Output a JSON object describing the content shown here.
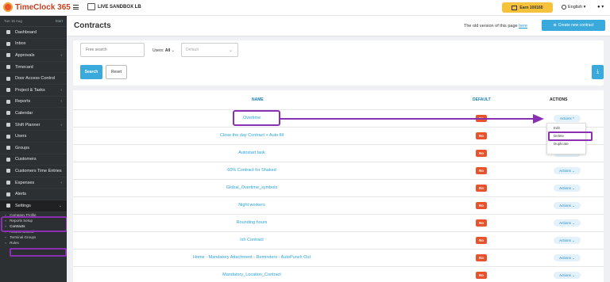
{
  "topbar": {
    "logo_text": "TimeClock 365",
    "sandbox_label": "LIVE SANDBOX LB",
    "earn_label": "Earn 100160",
    "language": "English ▾",
    "user_caret": "▾"
  },
  "sidebar": {
    "date_left": "Tue 16 Aug",
    "date_right": "Start",
    "items": [
      {
        "label": "Dashboard",
        "caret": ""
      },
      {
        "label": "Inbox",
        "caret": ""
      },
      {
        "label": "Approvals",
        "caret": "‹"
      },
      {
        "label": "Timecard",
        "caret": ""
      },
      {
        "label": "Door Access Control",
        "caret": ""
      },
      {
        "label": "Project & Tasks",
        "caret": "‹"
      },
      {
        "label": "Reports",
        "caret": "‹"
      },
      {
        "label": "Calendar",
        "caret": ""
      },
      {
        "label": "Shift Planner",
        "caret": "‹"
      },
      {
        "label": "Users",
        "caret": ""
      },
      {
        "label": "Groups",
        "caret": ""
      },
      {
        "label": "Customers",
        "caret": ""
      },
      {
        "label": "Customers Time Entries",
        "caret": ""
      },
      {
        "label": "Expenses",
        "caret": "‹"
      },
      {
        "label": "Alerts",
        "caret": ""
      },
      {
        "label": "Settings",
        "caret": "⌄"
      }
    ],
    "sub_items": [
      {
        "label": "Company Profile"
      },
      {
        "label": "Reports Setup"
      },
      {
        "label": "Contracts"
      },
      {
        "label": "Access Control"
      },
      {
        "label": "Terminal Groups"
      },
      {
        "label": "Rules"
      }
    ]
  },
  "header": {
    "title": "Contracts",
    "old_version_text": "The old version of this page",
    "old_version_link": "here",
    "create_button": "Create new contract"
  },
  "filters": {
    "search_placeholder": "Free search",
    "users_label": "Users:",
    "users_value": "All",
    "default_placeholder": "Default",
    "search_button": "Search",
    "reset_button": "Reset"
  },
  "table": {
    "columns": {
      "name": "NAME",
      "default": "DEFAULT",
      "actions": "ACTIONS"
    },
    "rows": [
      {
        "name": "Overtime",
        "default": "No",
        "actions": "Actions ^"
      },
      {
        "name": "Close the day Contract + Auto fill",
        "default": "No",
        "actions": "Actions ⌄"
      },
      {
        "name": "Autostart task",
        "default": "No",
        "actions": "Actions ⌄"
      },
      {
        "name": "60% Contract for Shaked",
        "default": "No",
        "actions": "Actions ⌄"
      },
      {
        "name": "Global_Overtime_symbols",
        "default": "No",
        "actions": "Actions ⌄"
      },
      {
        "name": "Night workers",
        "default": "No",
        "actions": "Actions ⌄"
      },
      {
        "name": "Rounding hours",
        "default": "No",
        "actions": "Actions ⌄"
      },
      {
        "name": "Ish Contract",
        "default": "No",
        "actions": "Actions ⌄"
      },
      {
        "name": "Home - Mandatory Attachment - Reminders - AutoPunch Out",
        "default": "No",
        "actions": "Actions ⌄"
      },
      {
        "name": "Mandatory_Location_Contract",
        "default": "No",
        "actions": "Actions ⌄"
      }
    ]
  },
  "dropdown": {
    "items": [
      "Edit",
      "Delete",
      "Duplicate"
    ]
  },
  "colors": {
    "accent": "#3aa9dc",
    "highlight": "#8b2fb5",
    "badge": "#e8532e",
    "sidebar": "#2d3033"
  }
}
